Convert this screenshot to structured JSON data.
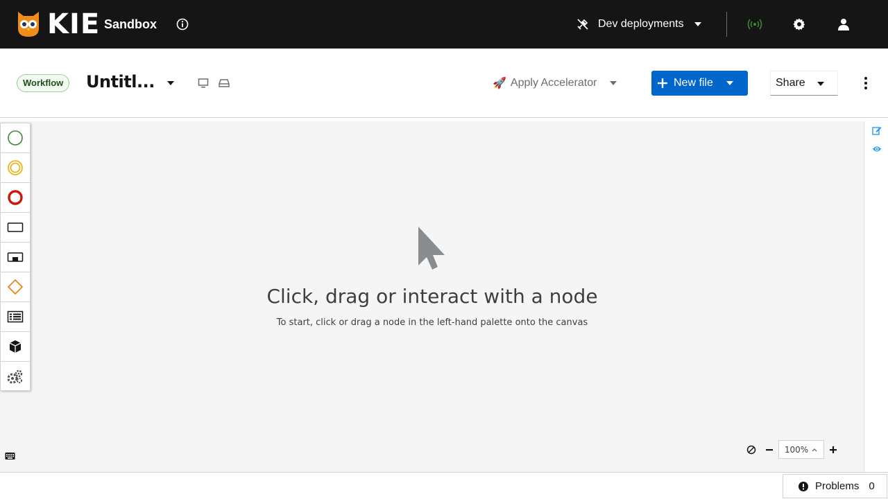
{
  "masthead": {
    "brand": "KIE",
    "product": "Sandbox",
    "dev_deployments_label": "Dev deployments",
    "icons": [
      "info-icon",
      "plug-off-icon",
      "broadcast-icon",
      "gear-icon",
      "user-icon"
    ],
    "connection_color": "#3e8635"
  },
  "toolbar": {
    "badge": "Workflow",
    "file_name": "Untitl...",
    "apply_accelerator": "Apply Accelerator",
    "accelerator_emoji": "🚀",
    "new_file": "New file",
    "share": "Share",
    "accent": "#0066cc"
  },
  "palette": {
    "items": [
      "start-event-icon",
      "intermediate-event-icon",
      "end-event-icon",
      "task-icon",
      "subprocess-icon",
      "gateway-icon",
      "data-object-icon",
      "custom-task-icon",
      "service-tasks-icon"
    ]
  },
  "canvas": {
    "empty_title": "Click, drag or interact with a node",
    "empty_subtitle": "To start, click or drag a node in the left-hand palette onto the canvas",
    "zoom_level": "100%"
  },
  "footer": {
    "problems_label": "Problems",
    "problems_count": "0"
  }
}
